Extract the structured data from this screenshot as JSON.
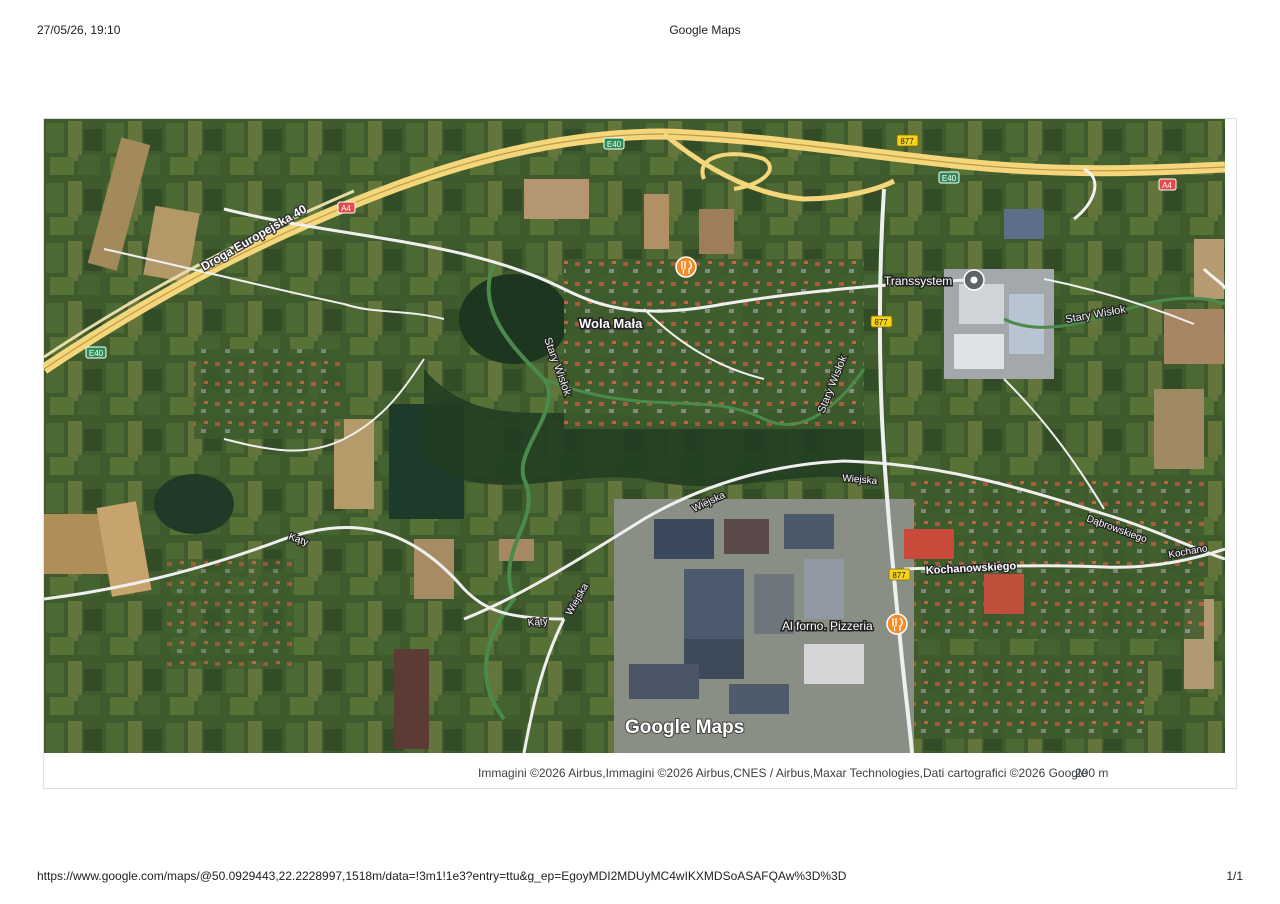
{
  "print_header": {
    "datetime": "27/05/26, 19:10",
    "title": "Google Maps"
  },
  "print_footer": {
    "url": "https://www.google.com/maps/@50.0929443,22.2228997,1518m/data=!3m1!1e3?entry=ttu&g_ep=EgoyMDI2MDUyMC4wIKXMDSoASAFQAw%3D%3D",
    "page": "1/1"
  },
  "map": {
    "view": "satellite",
    "logo_text": "Google Maps",
    "attribution": "Immagini ©2026 Airbus,Immagini ©2026 Airbus,CNES / Airbus,Maxar Technologies,Dati cartografici ©2026 Google",
    "scale": "200 m",
    "colors": {
      "road": "#f2f2f2",
      "motorway": "#f5d67a",
      "shield_motorway": "#2e8b57",
      "shield_highway": "#f6d21b",
      "shield_a4": "#e34a4a",
      "poi_food": "#f28c28",
      "poi_generic": "#5f6368"
    },
    "place_labels": {
      "village": "Wola Mała",
      "road_a": "Droga Europejska 40",
      "river_1": "Stary Wisłok",
      "river_2": "Stary Wisłok",
      "river_3": "Stary Wisłok",
      "street_wiejska_1": "Wiejska",
      "street_wiejska_2": "Wiejska",
      "street_wiejska_3": "Wiejska",
      "street_katy_1": "Kąty",
      "street_katy_2": "Kąty",
      "street_dabrowskiego": "Dąbrowskiego",
      "street_kochanowskiego": "Kochanowskiego",
      "street_kochano": "Kochano"
    },
    "shields": {
      "e40_a": "E40",
      "e40_b": "E40",
      "e40_c": "E40",
      "a4_a": "A4",
      "a4_b": "A4",
      "r877_a": "877",
      "r877_b": "877",
      "r877_c": "877"
    },
    "pois": {
      "transsystem": {
        "name": "Transsystem",
        "icon": "map-pin-icon"
      },
      "pizzeria": {
        "name": "Al forno. Pizzeria",
        "icon": "restaurant-icon"
      },
      "restaurant_north": {
        "name": "",
        "icon": "restaurant-icon"
      }
    }
  }
}
